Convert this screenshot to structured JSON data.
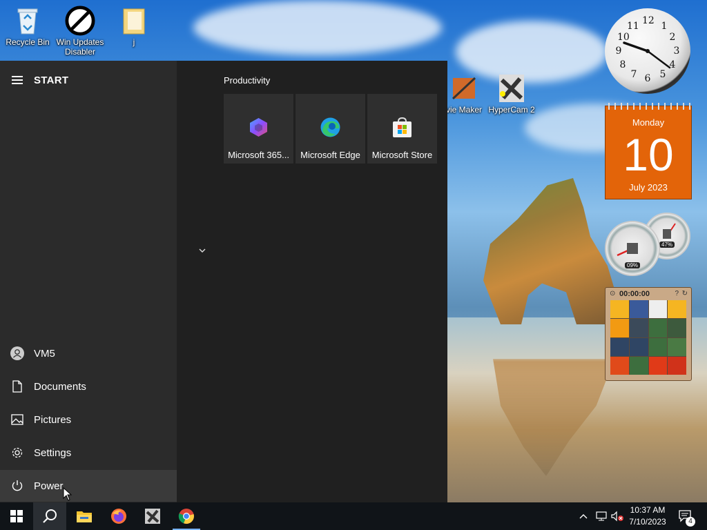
{
  "desktop": {
    "icons": [
      {
        "label": "Recycle Bin"
      },
      {
        "label": "Win Updates Disabler"
      },
      {
        "label": "j"
      },
      {
        "label": "vie Maker"
      },
      {
        "label": "HyperCam 2"
      }
    ]
  },
  "start_menu": {
    "title": "START",
    "side_items": [
      {
        "label": "VM5",
        "icon": "user-icon"
      },
      {
        "label": "Documents",
        "icon": "document-icon"
      },
      {
        "label": "Pictures",
        "icon": "pictures-icon"
      },
      {
        "label": "Settings",
        "icon": "gear-icon"
      },
      {
        "label": "Power",
        "icon": "power-icon"
      }
    ],
    "group_title": "Productivity",
    "tiles": [
      {
        "label": "Microsoft 365...",
        "icon": "microsoft-365-icon"
      },
      {
        "label": "Microsoft Edge",
        "icon": "edge-icon"
      },
      {
        "label": "Microsoft Store",
        "icon": "store-icon"
      }
    ]
  },
  "gadgets": {
    "calendar": {
      "day": "Monday",
      "date": "10",
      "month_year": "July 2023"
    },
    "clock_numbers": [
      "12",
      "1",
      "2",
      "3",
      "4",
      "5",
      "6",
      "7",
      "8",
      "9",
      "10",
      "11"
    ],
    "cpu_gauge": {
      "value": "09%"
    },
    "ram_gauge": {
      "value": "47%"
    },
    "puzzle": {
      "timer": "00:00:00"
    }
  },
  "taskbar": {
    "time": "10:37 AM",
    "date": "7/10/2023",
    "notification_count": "4",
    "accent": "#78b4ff"
  }
}
